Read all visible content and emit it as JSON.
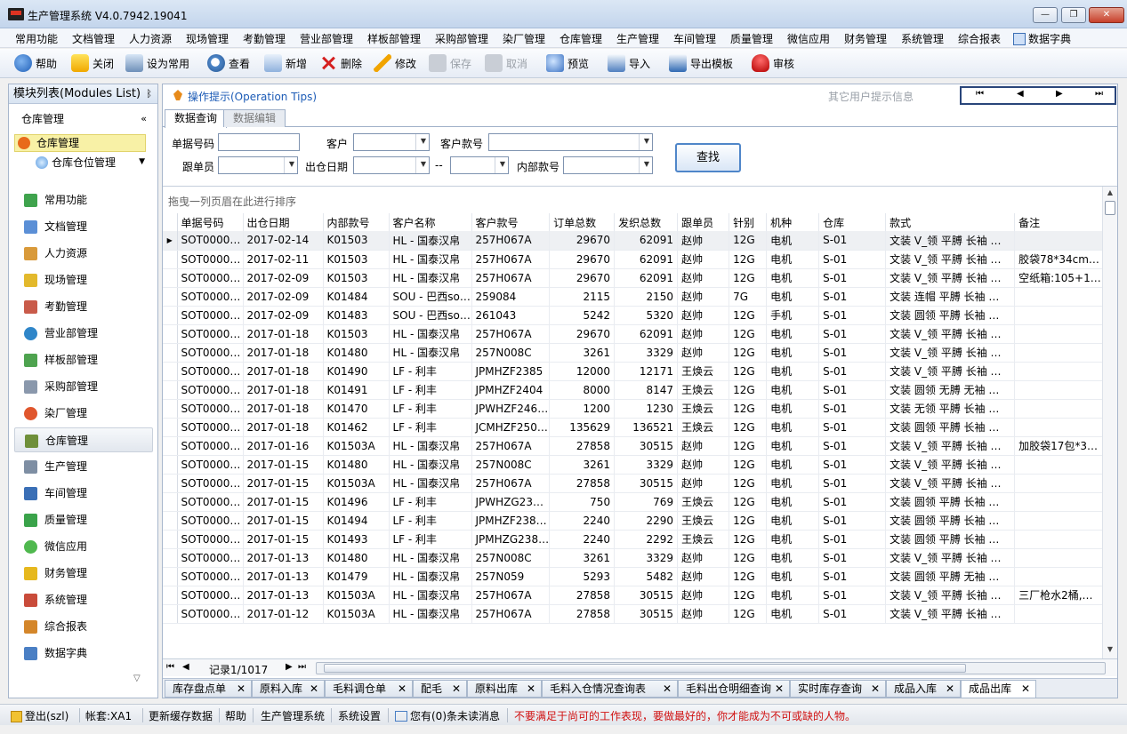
{
  "window": {
    "title": "生产管理系统 V4.0.7942.19041",
    "min": "—",
    "max": "❐",
    "close": "✕"
  },
  "menu": [
    "常用功能",
    "文档管理",
    "人力资源",
    "现场管理",
    "考勤管理",
    "营业部管理",
    "样板部管理",
    "采购部管理",
    "染厂管理",
    "仓库管理",
    "生产管理",
    "车间管理",
    "质量管理",
    "微信应用",
    "财务管理",
    "系统管理",
    "综合报表",
    "数据字典"
  ],
  "toolbar": {
    "help": "帮助",
    "close": "关闭",
    "favorite": "设为常用",
    "view": "查看",
    "add": "新增",
    "delete": "删除",
    "edit": "修改",
    "save": "保存",
    "cancel": "取消",
    "preview": "预览",
    "import": "导入",
    "export_template": "导出模板",
    "audit": "审核"
  },
  "left_panel": {
    "title": "模块列表(Modules List)",
    "pin": "ᛒ",
    "section": "仓库管理",
    "collapse": "«",
    "tree_selected": "仓库管理",
    "tree_child": "仓库仓位管理",
    "modules": [
      "常用功能",
      "文档管理",
      "人力资源",
      "现场管理",
      "考勤管理",
      "营业部管理",
      "样板部管理",
      "采购部管理",
      "染厂管理",
      "仓库管理",
      "生产管理",
      "车间管理",
      "质量管理",
      "微信应用",
      "财务管理",
      "系统管理",
      "综合报表",
      "数据字典"
    ],
    "active_module": "仓库管理"
  },
  "tips": {
    "label": "操作提示(Operation Tips)",
    "other": "其它用户提示信息",
    "nav_first": "⏮",
    "nav_prev": "◀",
    "nav_next": "▶",
    "nav_last": "⏭"
  },
  "subtabs": [
    "数据查询",
    "数据编辑"
  ],
  "query": {
    "doc_no_label": "单据号码",
    "customer_label": "客户",
    "cust_style_label": "客户款号",
    "follower_label": "跟单员",
    "out_date_label": "出仓日期",
    "date_sep": "--",
    "inner_style_label": "内部款号",
    "search_button": "查找"
  },
  "grid": {
    "group_hint": "拖曳一列页眉在此进行排序",
    "columns": [
      "单据号码",
      "出仓日期",
      "内部款号",
      "客户名称",
      "客户款号",
      "订单总数",
      "发织总数",
      "跟单员",
      "针别",
      "机种",
      "仓库",
      "款式",
      "备注"
    ],
    "rows": [
      [
        "SOT0000…",
        "2017-02-14",
        "K01503",
        "HL - 国泰汉帛",
        "257H067A",
        "29670",
        "62091",
        "赵帅",
        "12G",
        "电机",
        "S-01",
        "文装  V_领  平膊  长袖 …",
        ""
      ],
      [
        "SOT0000…",
        "2017-02-11",
        "K01503",
        "HL - 国泰汉帛",
        "257H067A",
        "29670",
        "62091",
        "赵帅",
        "12G",
        "电机",
        "S-01",
        "文装  V_领  平膊  长袖 …",
        "胶袋78*34cm…"
      ],
      [
        "SOT0000…",
        "2017-02-09",
        "K01503",
        "HL - 国泰汉帛",
        "257H067A",
        "29670",
        "62091",
        "赵帅",
        "12G",
        "电机",
        "S-01",
        "文装  V_领  平膊  长袖 …",
        "空纸箱:105+1…"
      ],
      [
        "SOT0000…",
        "2017-02-09",
        "K01484",
        "SOU - 巴西so…",
        "259084",
        "2115",
        "2150",
        "赵帅",
        "7G",
        "电机",
        "S-01",
        "文装  连帽  平膊  长袖 …",
        ""
      ],
      [
        "SOT0000…",
        "2017-02-09",
        "K01483",
        "SOU - 巴西so…",
        "261043",
        "5242",
        "5320",
        "赵帅",
        "12G",
        "手机",
        "S-01",
        "文装  圆领  平膊  长袖 …",
        ""
      ],
      [
        "SOT0000…",
        "2017-01-18",
        "K01503",
        "HL - 国泰汉帛",
        "257H067A",
        "29670",
        "62091",
        "赵帅",
        "12G",
        "电机",
        "S-01",
        "文装  V_领  平膊  长袖 …",
        ""
      ],
      [
        "SOT0000…",
        "2017-01-18",
        "K01480",
        "HL - 国泰汉帛",
        "257N008C",
        "3261",
        "3329",
        "赵帅",
        "12G",
        "电机",
        "S-01",
        "文装  V_领  平膊  长袖 …",
        ""
      ],
      [
        "SOT0000…",
        "2017-01-18",
        "K01490",
        "LF - 利丰",
        "JPMHZF2385",
        "12000",
        "12171",
        "王焕云",
        "12G",
        "电机",
        "S-01",
        "文装  V_领  平膊  长袖 …",
        ""
      ],
      [
        "SOT0000…",
        "2017-01-18",
        "K01491",
        "LF - 利丰",
        "JPMHZF2404",
        "8000",
        "8147",
        "王焕云",
        "12G",
        "电机",
        "S-01",
        "文装  圆领  无膊  无袖  …",
        ""
      ],
      [
        "SOT0000…",
        "2017-01-18",
        "K01470",
        "LF - 利丰",
        "JPWHZF246…",
        "1200",
        "1230",
        "王焕云",
        "12G",
        "电机",
        "S-01",
        "文装  无领   平膊   长袖 …",
        ""
      ],
      [
        "SOT0000…",
        "2017-01-18",
        "K01462",
        "LF - 利丰",
        "JCMHZF250…",
        "135629",
        "136521",
        "王焕云",
        "12G",
        "电机",
        "S-01",
        "文装  圆领  平膊  长袖 …",
        ""
      ],
      [
        "SOT0000…",
        "2017-01-16",
        "K01503A",
        "HL - 国泰汉帛",
        "257H067A",
        "27858",
        "30515",
        "赵帅",
        "12G",
        "电机",
        "S-01",
        "文装  V_领  平膊  长袖 …",
        "加胶袋17包*3…"
      ],
      [
        "SOT0000…",
        "2017-01-15",
        "K01480",
        "HL - 国泰汉帛",
        "257N008C",
        "3261",
        "3329",
        "赵帅",
        "12G",
        "电机",
        "S-01",
        "文装  V_领  平膊  长袖 …",
        ""
      ],
      [
        "SOT0000…",
        "2017-01-15",
        "K01503A",
        "HL - 国泰汉帛",
        "257H067A",
        "27858",
        "30515",
        "赵帅",
        "12G",
        "电机",
        "S-01",
        "文装  V_领  平膊  长袖 …",
        ""
      ],
      [
        "SOT0000…",
        "2017-01-15",
        "K01496",
        "LF - 利丰",
        "JPWHZG23…",
        "750",
        "769",
        "王焕云",
        "12G",
        "电机",
        "S-01",
        "文装  圆领  平膊  长袖 …",
        ""
      ],
      [
        "SOT0000…",
        "2017-01-15",
        "K01494",
        "LF - 利丰",
        "JPMHZF238…",
        "2240",
        "2290",
        "王焕云",
        "12G",
        "电机",
        "S-01",
        "文装  圆领  平膊  长袖 …",
        ""
      ],
      [
        "SOT0000…",
        "2017-01-15",
        "K01493",
        "LF - 利丰",
        "JPMHZG238…",
        "2240",
        "2292",
        "王焕云",
        "12G",
        "电机",
        "S-01",
        "文装  圆领  平膊  长袖 …",
        ""
      ],
      [
        "SOT0000…",
        "2017-01-13",
        "K01480",
        "HL - 国泰汉帛",
        "257N008C",
        "3261",
        "3329",
        "赵帅",
        "12G",
        "电机",
        "S-01",
        "文装  V_领  平膊  长袖 …",
        ""
      ],
      [
        "SOT0000…",
        "2017-01-13",
        "K01479",
        "HL - 国泰汉帛",
        "257N059",
        "5293",
        "5482",
        "赵帅",
        "12G",
        "电机",
        "S-01",
        "文装  圆领  平膊  无袖 …",
        ""
      ],
      [
        "SOT0000…",
        "2017-01-13",
        "K01503A",
        "HL - 国泰汉帛",
        "257H067A",
        "27858",
        "30515",
        "赵帅",
        "12G",
        "电机",
        "S-01",
        "文装  V_领  平膊  长袖 …",
        "三厂枪水2桶,…"
      ],
      [
        "SOT0000…",
        "2017-01-12",
        "K01503A",
        "HL - 国泰汉帛",
        "257H067A",
        "27858",
        "30515",
        "赵帅",
        "12G",
        "电机",
        "S-01",
        "文装  V_领  平膊  长袖 …",
        ""
      ]
    ]
  },
  "pager": {
    "first": "⏮",
    "prev": "◀",
    "text": "记录1/1017",
    "next": "▶",
    "last": "⏭",
    "hleft": "◂"
  },
  "doc_tabs": [
    "库存盘点单",
    "原料入库",
    "毛料调仓单",
    "配毛",
    "原料出库",
    "毛料入仓情况查询表",
    "毛料出仓明细查询",
    "实时库存查询",
    "成品入库",
    "成品出库"
  ],
  "doc_tab_active": "成品出库",
  "status": {
    "logout": "登出(szl)",
    "account": "帐套:XA1",
    "refresh_cache": "更新缓存数据",
    "help": "帮助",
    "system": "生产管理系统",
    "settings": "系统设置",
    "unread": "您有(0)条未读消息",
    "motto": "不要满足于尚可的工作表现，要做最好的，你才能成为不可或缺的人物。"
  }
}
